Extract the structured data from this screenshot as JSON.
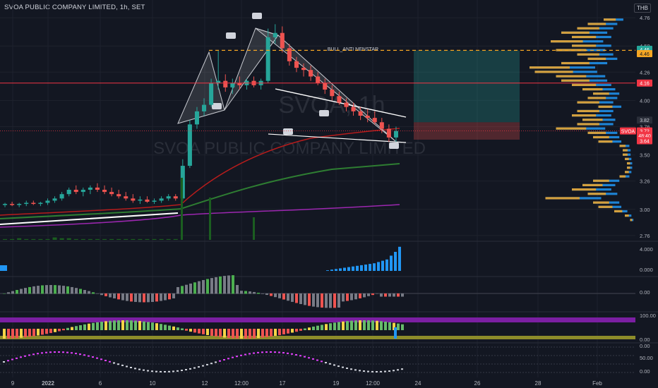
{
  "header": {
    "title": "SVOA PUBLIC COMPANY LIMITED, 1h, SET",
    "currency": "THB"
  },
  "chart_data": {
    "type": "candlestick",
    "title": "SVOA PUBLIC COMPANY LIMITED, 1h, SET",
    "watermark_symbol": "SVOA, 1h",
    "watermark_name": "SVOA PUBLIC COMPANY LIMITED",
    "pattern_label": "BULL_ANTI NENSTAR",
    "ylim": [
      2.72,
      4.78
    ],
    "price_ticks": [
      2.76,
      3.0,
      3.26,
      3.5,
      3.76,
      4.0,
      4.26,
      4.5,
      4.76
    ],
    "x_tick_labels": [
      "9",
      "2022",
      "6",
      "10",
      "12",
      "12:00",
      "17",
      "19",
      "12:00",
      "24",
      "26",
      "28",
      "Feb"
    ],
    "price_labels": [
      {
        "text": "4.46",
        "price": 4.47,
        "color": "#26a69a",
        "text_color": "#ffffff"
      },
      {
        "text": "4.46",
        "price": 4.43,
        "color": "#f5a623",
        "text_color": "#131722"
      },
      {
        "text": "4.16",
        "price": 4.16,
        "color": "#f23645",
        "text_color": "#ffffff"
      },
      {
        "text": "3.82",
        "price": 3.82,
        "color": "#2a2e39",
        "text_color": "#d1d4dc"
      },
      {
        "text": "SVOA",
        "price": 3.72,
        "color": "#f23645",
        "text_color": "#ffffff"
      },
      {
        "text": "3.72",
        "price": 3.72,
        "color": "#f23645",
        "text_color": "#ffffff"
      },
      {
        "text": "48:40",
        "price": 3.68,
        "color": "#f23645",
        "text_color": "#ffffff"
      },
      {
        "text": "3.64",
        "price": 3.63,
        "color": "#f23645",
        "text_color": "#ffffff"
      }
    ],
    "last_price": 3.72,
    "target_price": 4.46,
    "resistance_price": 4.16,
    "stop_price": 3.64,
    "candles": [
      [
        3.04,
        3.06,
        3.02,
        3.05
      ],
      [
        3.05,
        3.07,
        3.03,
        3.04
      ],
      [
        3.04,
        3.06,
        3.02,
        3.05
      ],
      [
        3.05,
        3.08,
        3.03,
        3.06
      ],
      [
        3.06,
        3.08,
        3.04,
        3.05
      ],
      [
        3.05,
        3.07,
        3.03,
        3.06
      ],
      [
        3.06,
        3.1,
        3.04,
        3.08
      ],
      [
        3.08,
        3.12,
        3.06,
        3.1
      ],
      [
        3.1,
        3.16,
        3.08,
        3.14
      ],
      [
        3.14,
        3.2,
        3.12,
        3.18
      ],
      [
        3.18,
        3.22,
        3.14,
        3.16
      ],
      [
        3.16,
        3.2,
        3.12,
        3.18
      ],
      [
        3.18,
        3.22,
        3.14,
        3.2
      ],
      [
        3.2,
        3.24,
        3.16,
        3.18
      ],
      [
        3.18,
        3.22,
        3.14,
        3.16
      ],
      [
        3.16,
        3.2,
        3.12,
        3.14
      ],
      [
        3.14,
        3.18,
        3.1,
        3.12
      ],
      [
        3.12,
        3.16,
        3.08,
        3.1
      ],
      [
        3.1,
        3.14,
        3.06,
        3.08
      ],
      [
        3.08,
        3.12,
        3.05,
        3.09
      ],
      [
        3.09,
        3.12,
        3.06,
        3.07
      ],
      [
        3.07,
        3.1,
        3.05,
        3.08
      ],
      [
        3.08,
        3.12,
        3.06,
        3.1
      ],
      [
        3.1,
        3.14,
        3.08,
        3.12
      ],
      [
        3.12,
        3.14,
        3.08,
        3.1
      ],
      [
        3.1,
        3.46,
        3.08,
        3.4
      ],
      [
        3.4,
        3.82,
        3.38,
        3.78
      ],
      [
        3.78,
        3.94,
        3.74,
        3.9
      ],
      [
        3.9,
        4.02,
        3.86,
        3.96
      ],
      [
        3.96,
        4.2,
        3.94,
        4.16
      ],
      [
        4.16,
        4.46,
        4.1,
        4.18
      ],
      [
        4.18,
        4.24,
        4.08,
        4.12
      ],
      [
        4.12,
        4.2,
        4.06,
        4.16
      ],
      [
        4.16,
        4.22,
        4.1,
        4.14
      ],
      [
        4.14,
        4.2,
        4.1,
        4.18
      ],
      [
        4.18,
        4.22,
        4.12,
        4.14
      ],
      [
        4.14,
        4.2,
        4.1,
        4.18
      ],
      [
        4.18,
        4.66,
        4.16,
        4.58
      ],
      [
        4.58,
        4.7,
        4.52,
        4.62
      ],
      [
        4.62,
        4.68,
        4.44,
        4.48
      ],
      [
        4.48,
        4.52,
        4.32,
        4.36
      ],
      [
        4.36,
        4.4,
        4.26,
        4.3
      ],
      [
        4.3,
        4.34,
        4.22,
        4.28
      ],
      [
        4.28,
        4.32,
        4.18,
        4.22
      ],
      [
        4.22,
        4.26,
        4.14,
        4.16
      ],
      [
        4.16,
        4.2,
        4.06,
        4.1
      ],
      [
        4.1,
        4.14,
        4.0,
        4.04
      ],
      [
        4.04,
        4.08,
        3.96,
        3.98
      ],
      [
        3.98,
        4.02,
        3.9,
        3.94
      ],
      [
        3.94,
        3.98,
        3.86,
        3.9
      ],
      [
        3.9,
        3.94,
        3.82,
        3.86
      ],
      [
        3.86,
        3.92,
        3.8,
        3.84
      ],
      [
        3.84,
        3.9,
        3.78,
        3.8
      ],
      [
        3.8,
        3.84,
        3.7,
        3.74
      ],
      [
        3.74,
        3.78,
        3.62,
        3.66
      ],
      [
        3.66,
        3.76,
        3.62,
        3.72
      ]
    ],
    "volume_bars": [
      0.1,
      0.1,
      0.2,
      0.1,
      0.1,
      0.1,
      0.1,
      0.3,
      0.2,
      0.2,
      0.1,
      0.1,
      0.1,
      0.1,
      0.1,
      0.1,
      0.1,
      0.1,
      0.1,
      0.1,
      0.1,
      0.1,
      0.1,
      0.1,
      0.1,
      4.0,
      2.2,
      0.8,
      0.6,
      1.0,
      0.8,
      0.5,
      0.4,
      0.3,
      0.3,
      0.3,
      0.3,
      1.6,
      0.9,
      0.6,
      0.4,
      0.3,
      0.3,
      0.3,
      0.2,
      0.2,
      0.2,
      0.2,
      0.2,
      0.2,
      0.2,
      0.2,
      0.2,
      0.2,
      0.3,
      0.2
    ],
    "profile_levels": [
      4.74,
      4.7,
      4.66,
      4.62,
      4.58,
      4.54,
      4.5,
      4.46,
      4.42,
      4.38,
      4.34,
      4.3,
      4.26,
      4.22,
      4.18,
      4.14,
      4.1,
      4.06,
      4.02,
      3.98,
      3.94,
      3.9,
      3.86,
      3.82,
      3.78,
      3.74,
      3.7,
      3.66,
      3.62,
      3.58,
      3.54,
      3.5,
      3.46,
      3.42,
      3.38,
      3.34,
      3.3,
      3.26,
      3.22,
      3.18,
      3.14,
      3.1,
      3.06,
      3.02,
      2.98,
      2.94,
      2.9
    ],
    "profile_sizes": [
      0.3,
      0.45,
      0.55,
      0.7,
      0.6,
      0.8,
      0.6,
      0.75,
      0.55,
      0.45,
      0.7,
      1.0,
      0.95,
      0.75,
      0.7,
      0.6,
      0.5,
      0.4,
      0.45,
      0.55,
      0.35,
      0.55,
      0.6,
      0.5,
      0.55,
      0.75,
      0.45,
      0.4,
      0.35,
      0.15,
      0.12,
      0.12,
      0.1,
      0.08,
      0.08,
      0.1,
      0.15,
      0.4,
      0.5,
      0.6,
      0.45,
      0.85,
      0.4,
      0.35,
      0.2,
      0.1,
      0.05
    ],
    "indicator_scales": {
      "volume": [
        "4.000",
        "0.000"
      ],
      "oscillator": [
        "0.00"
      ],
      "rsi": [
        "100.00",
        "0.00"
      ],
      "stoch": [
        "0.00",
        "50.00",
        "0.00"
      ]
    },
    "legend_position": "none",
    "grid": true,
    "colors": {
      "background": "#131722",
      "up": "#26a69a",
      "down": "#ef5350",
      "text": "#b2b5be",
      "target_line": "#f5a623",
      "resistance_line": "#f23645",
      "ma_green": "#2e7d32",
      "ma_red": "#b71c1c",
      "ma_purple": "#9c27b0",
      "profile_up": "#2196f3",
      "profile_down": "#f5a623",
      "rsi_band": "#7b1fa2",
      "rsi_mid": "#8d8c2a"
    }
  }
}
